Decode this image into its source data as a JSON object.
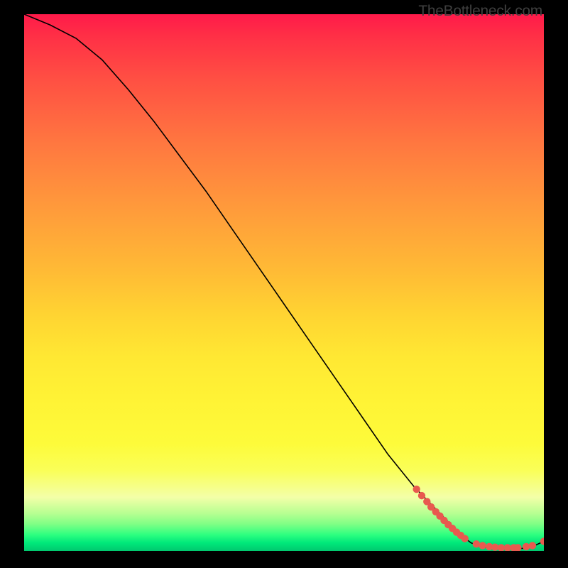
{
  "watermark": "TheBottleneck.com",
  "chart_data": {
    "type": "line",
    "title": "",
    "xlabel": "",
    "ylabel": "",
    "xlim": [
      0,
      100
    ],
    "ylim": [
      0,
      100
    ],
    "x": [
      0,
      5,
      10,
      15,
      20,
      25,
      30,
      35,
      40,
      45,
      50,
      55,
      60,
      65,
      70,
      75,
      80,
      84,
      86,
      88,
      90,
      92,
      94,
      96,
      98,
      100
    ],
    "y": [
      100,
      98,
      95.5,
      91.5,
      86,
      80,
      73.5,
      67,
      60,
      53,
      46,
      39,
      32,
      25,
      18,
      12,
      7,
      3,
      1.5,
      0.8,
      0.5,
      0.4,
      0.4,
      0.5,
      0.9,
      1.8
    ],
    "marker_segments": [
      {
        "x": [
          75.5,
          76.5,
          77.5,
          78.3,
          79.2,
          80
        ],
        "y": [
          11.5,
          10.3,
          9.2,
          8.2,
          7.3,
          6.5
        ]
      },
      {
        "x": [
          80.8,
          81.6,
          82.4,
          83.2,
          84,
          84.8
        ],
        "y": [
          5.7,
          4.9,
          4.2,
          3.5,
          2.9,
          2.3
        ]
      },
      {
        "x": [
          87,
          88.2,
          89.5,
          90.6,
          91.8,
          93,
          94.2,
          95
        ],
        "y": [
          1.3,
          1.0,
          0.8,
          0.7,
          0.6,
          0.6,
          0.6,
          0.6
        ]
      },
      {
        "x": [
          96.6,
          97.8
        ],
        "y": [
          0.8,
          1.0
        ]
      },
      {
        "x": [
          100
        ],
        "y": [
          1.8
        ]
      }
    ],
    "marker_color": "#e8594f",
    "line_color": "#000000"
  },
  "gradient_colors": {
    "top": "#ff1a4a",
    "mid_upper": "#ff9a3b",
    "mid": "#ffe833",
    "mid_lower": "#faff58",
    "bottom": "#00c86f"
  }
}
